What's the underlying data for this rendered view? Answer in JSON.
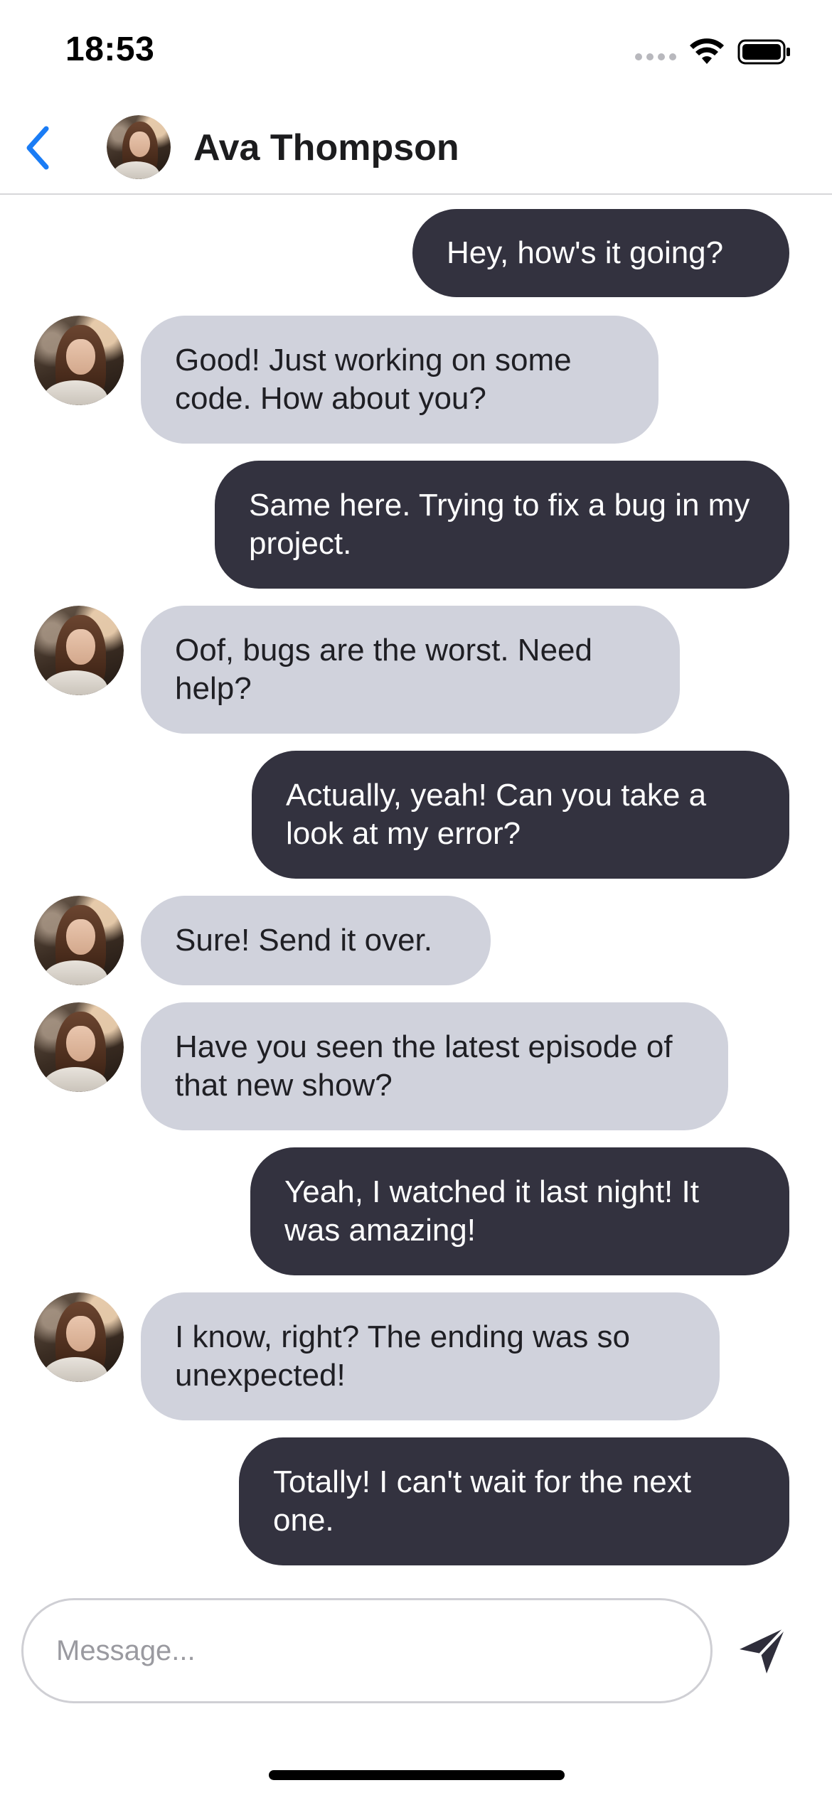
{
  "status_bar": {
    "time": "18:53",
    "icons": [
      "signal-icon",
      "wifi-icon",
      "battery-icon"
    ]
  },
  "header": {
    "back_icon": "chevron-left-icon",
    "contact_name": "Ava Thompson",
    "accent_color": "#1a7cf5"
  },
  "colors": {
    "sent_bubble": "#33323f",
    "received_bubble": "#d0d2dc",
    "sent_text": "#ffffff",
    "received_text": "#1f1f24"
  },
  "messages": [
    {
      "sender": "me",
      "text": "Hey, how's it going?"
    },
    {
      "sender": "Ava Thompson",
      "text": "Good! Just working on some code. How about you?"
    },
    {
      "sender": "me",
      "text": "Same here. Trying to fix a bug in my project."
    },
    {
      "sender": "Ava Thompson",
      "text": "Oof, bugs are the worst. Need help?"
    },
    {
      "sender": "me",
      "text": "Actually, yeah! Can you take a look at my error?"
    },
    {
      "sender": "Ava Thompson",
      "text": "Sure! Send it over."
    },
    {
      "sender": "Ava Thompson",
      "text": "Have you seen the latest episode of that new show?"
    },
    {
      "sender": "me",
      "text": "Yeah, I watched it last night! It was amazing!"
    },
    {
      "sender": "Ava Thompson",
      "text": "I know, right? The ending was so unexpected!"
    },
    {
      "sender": "me",
      "text": "Totally! I can't wait for the next one."
    }
  ],
  "composer": {
    "placeholder": "Message...",
    "value": "",
    "send_icon": "paper-plane-icon"
  }
}
